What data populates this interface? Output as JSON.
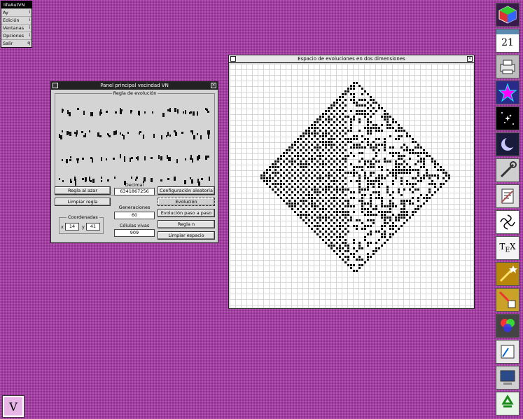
{
  "app_menu": {
    "title": "lifeAutVN",
    "items": [
      {
        "label": "Ay",
        "arrow": "i"
      },
      {
        "label": "Edición",
        "arrow": "i"
      },
      {
        "label": "Ventanas",
        "arrow": "i"
      },
      {
        "label": "Opciones",
        "arrow": "i"
      },
      {
        "label": "Salir",
        "arrow": "q"
      }
    ]
  },
  "panel": {
    "title": "Panel principal vecindad VN",
    "close_glyph": "×",
    "rules_label": "Regla de evolución",
    "buttons": {
      "random_rule": "Regla al azar",
      "clear_rule": "Limpiar regla",
      "config_random": "Configuración aleatoria",
      "evolution": "Evolución",
      "step_evolution": "Evolución paso a paso",
      "rule_n": "Regla n",
      "clear_space": "Limpiar espacio"
    },
    "decimal": {
      "label": "Decimal",
      "value": "6341867256"
    },
    "generations": {
      "label": "Generaciones",
      "value": "60"
    },
    "cells": {
      "label": "Células vivas",
      "value": "909"
    },
    "coords": {
      "label": "Coordenadas",
      "x_label": "x",
      "x_value": "14",
      "y_label": "y",
      "y_value": "41"
    }
  },
  "evolution_window": {
    "title": "Espacio de evoluciones en dos dimensiones",
    "close_glyph": "×"
  },
  "dock": {
    "icons": [
      "cube-icon",
      "calendar-icon",
      "printer-icon",
      "star-icon",
      "starfield-icon",
      "moon-icon",
      "tools-icon",
      "document-icon",
      "chaos-icon",
      "tex-icon",
      "wand-icon",
      "paint-icon",
      "color-icon",
      "editor-icon",
      "monitor-icon",
      "recycle-icon"
    ],
    "calendar_day": "21"
  },
  "desktop_v_label": "V"
}
